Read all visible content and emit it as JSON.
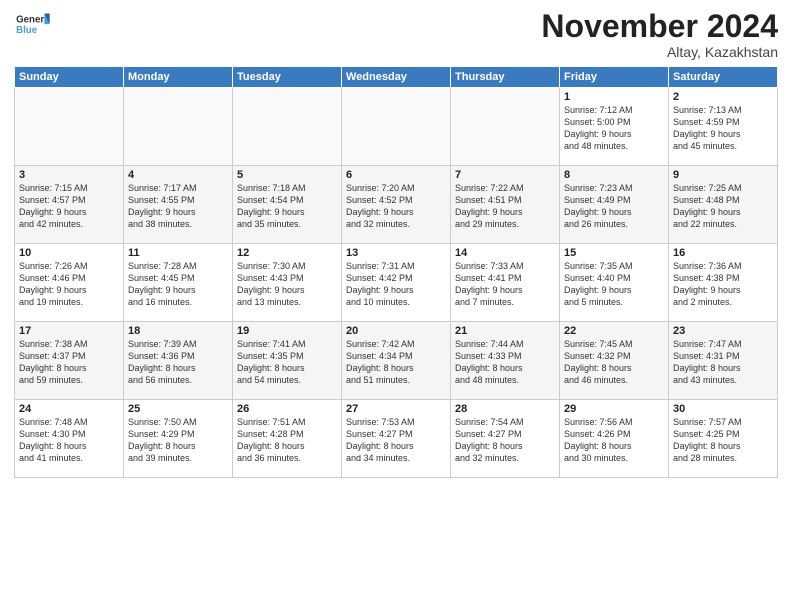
{
  "logo": {
    "line1": "General",
    "line2": "Blue"
  },
  "title": "November 2024",
  "location": "Altay, Kazakhstan",
  "days_of_week": [
    "Sunday",
    "Monday",
    "Tuesday",
    "Wednesday",
    "Thursday",
    "Friday",
    "Saturday"
  ],
  "weeks": [
    [
      {
        "day": "",
        "info": ""
      },
      {
        "day": "",
        "info": ""
      },
      {
        "day": "",
        "info": ""
      },
      {
        "day": "",
        "info": ""
      },
      {
        "day": "",
        "info": ""
      },
      {
        "day": "1",
        "info": "Sunrise: 7:12 AM\nSunset: 5:00 PM\nDaylight: 9 hours\nand 48 minutes."
      },
      {
        "day": "2",
        "info": "Sunrise: 7:13 AM\nSunset: 4:59 PM\nDaylight: 9 hours\nand 45 minutes."
      }
    ],
    [
      {
        "day": "3",
        "info": "Sunrise: 7:15 AM\nSunset: 4:57 PM\nDaylight: 9 hours\nand 42 minutes."
      },
      {
        "day": "4",
        "info": "Sunrise: 7:17 AM\nSunset: 4:55 PM\nDaylight: 9 hours\nand 38 minutes."
      },
      {
        "day": "5",
        "info": "Sunrise: 7:18 AM\nSunset: 4:54 PM\nDaylight: 9 hours\nand 35 minutes."
      },
      {
        "day": "6",
        "info": "Sunrise: 7:20 AM\nSunset: 4:52 PM\nDaylight: 9 hours\nand 32 minutes."
      },
      {
        "day": "7",
        "info": "Sunrise: 7:22 AM\nSunset: 4:51 PM\nDaylight: 9 hours\nand 29 minutes."
      },
      {
        "day": "8",
        "info": "Sunrise: 7:23 AM\nSunset: 4:49 PM\nDaylight: 9 hours\nand 26 minutes."
      },
      {
        "day": "9",
        "info": "Sunrise: 7:25 AM\nSunset: 4:48 PM\nDaylight: 9 hours\nand 22 minutes."
      }
    ],
    [
      {
        "day": "10",
        "info": "Sunrise: 7:26 AM\nSunset: 4:46 PM\nDaylight: 9 hours\nand 19 minutes."
      },
      {
        "day": "11",
        "info": "Sunrise: 7:28 AM\nSunset: 4:45 PM\nDaylight: 9 hours\nand 16 minutes."
      },
      {
        "day": "12",
        "info": "Sunrise: 7:30 AM\nSunset: 4:43 PM\nDaylight: 9 hours\nand 13 minutes."
      },
      {
        "day": "13",
        "info": "Sunrise: 7:31 AM\nSunset: 4:42 PM\nDaylight: 9 hours\nand 10 minutes."
      },
      {
        "day": "14",
        "info": "Sunrise: 7:33 AM\nSunset: 4:41 PM\nDaylight: 9 hours\nand 7 minutes."
      },
      {
        "day": "15",
        "info": "Sunrise: 7:35 AM\nSunset: 4:40 PM\nDaylight: 9 hours\nand 5 minutes."
      },
      {
        "day": "16",
        "info": "Sunrise: 7:36 AM\nSunset: 4:38 PM\nDaylight: 9 hours\nand 2 minutes."
      }
    ],
    [
      {
        "day": "17",
        "info": "Sunrise: 7:38 AM\nSunset: 4:37 PM\nDaylight: 8 hours\nand 59 minutes."
      },
      {
        "day": "18",
        "info": "Sunrise: 7:39 AM\nSunset: 4:36 PM\nDaylight: 8 hours\nand 56 minutes."
      },
      {
        "day": "19",
        "info": "Sunrise: 7:41 AM\nSunset: 4:35 PM\nDaylight: 8 hours\nand 54 minutes."
      },
      {
        "day": "20",
        "info": "Sunrise: 7:42 AM\nSunset: 4:34 PM\nDaylight: 8 hours\nand 51 minutes."
      },
      {
        "day": "21",
        "info": "Sunrise: 7:44 AM\nSunset: 4:33 PM\nDaylight: 8 hours\nand 48 minutes."
      },
      {
        "day": "22",
        "info": "Sunrise: 7:45 AM\nSunset: 4:32 PM\nDaylight: 8 hours\nand 46 minutes."
      },
      {
        "day": "23",
        "info": "Sunrise: 7:47 AM\nSunset: 4:31 PM\nDaylight: 8 hours\nand 43 minutes."
      }
    ],
    [
      {
        "day": "24",
        "info": "Sunrise: 7:48 AM\nSunset: 4:30 PM\nDaylight: 8 hours\nand 41 minutes."
      },
      {
        "day": "25",
        "info": "Sunrise: 7:50 AM\nSunset: 4:29 PM\nDaylight: 8 hours\nand 39 minutes."
      },
      {
        "day": "26",
        "info": "Sunrise: 7:51 AM\nSunset: 4:28 PM\nDaylight: 8 hours\nand 36 minutes."
      },
      {
        "day": "27",
        "info": "Sunrise: 7:53 AM\nSunset: 4:27 PM\nDaylight: 8 hours\nand 34 minutes."
      },
      {
        "day": "28",
        "info": "Sunrise: 7:54 AM\nSunset: 4:27 PM\nDaylight: 8 hours\nand 32 minutes."
      },
      {
        "day": "29",
        "info": "Sunrise: 7:56 AM\nSunset: 4:26 PM\nDaylight: 8 hours\nand 30 minutes."
      },
      {
        "day": "30",
        "info": "Sunrise: 7:57 AM\nSunset: 4:25 PM\nDaylight: 8 hours\nand 28 minutes."
      }
    ]
  ]
}
